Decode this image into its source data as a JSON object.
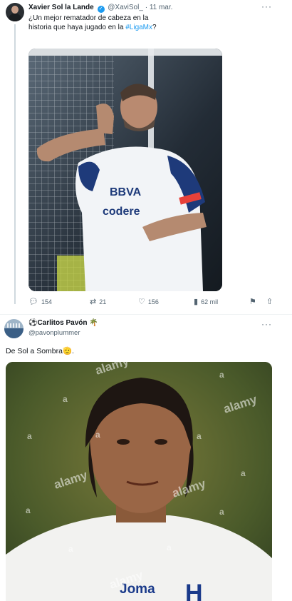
{
  "tweet1": {
    "author_name": "Xavier Sol la Lande",
    "handle": "@XaviSol_",
    "separator": "·",
    "date": "11 mar.",
    "more_icon": "more-horizontal-icon",
    "more_label": "···",
    "text_part1": "¿Un mejor rematador de cabeza en la historia que haya jugado en la ",
    "hashtag": "#LigaMx",
    "text_part2": "?",
    "jersey": {
      "sponsor1": "BBVA",
      "sponsor2": "codere"
    },
    "actions": {
      "replies": "154",
      "retweets": "21",
      "likes": "156",
      "views": "62 mil"
    }
  },
  "tweet2": {
    "author_emoji": "⚽",
    "author_name": "Carlitos Pavón",
    "author_suffix": "🌴",
    "handle": "@pavonplummer",
    "more_label": "···",
    "text": "De Sol a Sombra",
    "text_emoji": "🫡",
    "text_end": ".",
    "jersey_brand": "Joma",
    "watermarks": [
      "alamy",
      "alamy",
      "alamy",
      "alamy",
      "alamy"
    ],
    "marks": [
      "a",
      "a",
      "a",
      "a",
      "a",
      "a",
      "a",
      "a",
      "a",
      "a"
    ]
  },
  "colors": {
    "accent": "#1d9bf0",
    "secondary_text": "#536471",
    "primary_text": "#0f1419"
  }
}
